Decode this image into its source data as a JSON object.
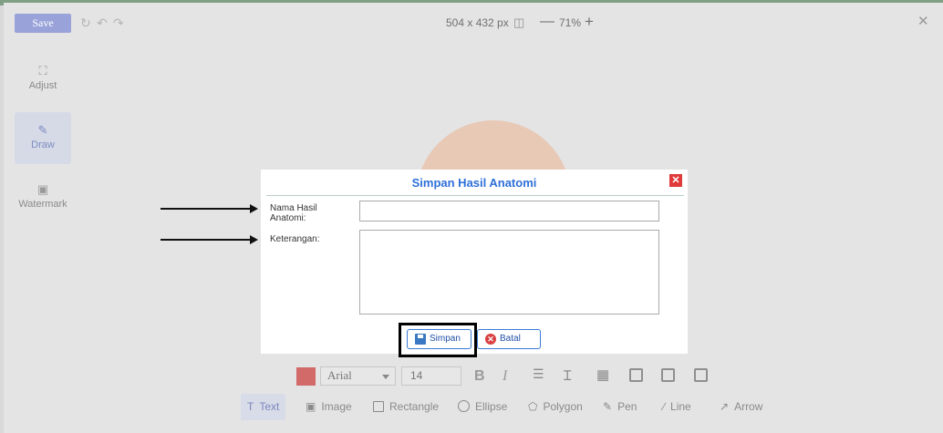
{
  "editor": {
    "save_label": "Save",
    "dimensions": "504 x 432 px",
    "zoom": "71%",
    "undo_icon": "rotate-icon",
    "sidebar": [
      {
        "label": "Adjust",
        "icon": "crop-icon"
      },
      {
        "label": "Draw",
        "icon": "pencil-square-icon"
      },
      {
        "label": "Watermark",
        "icon": "image-icon"
      }
    ],
    "text_toolbar": {
      "color": "#d26a6a",
      "font": "Arial",
      "font_size": "14",
      "bold": "B",
      "italic": "I"
    },
    "tools": [
      {
        "label": "Text",
        "icon": "text-cursor-icon"
      },
      {
        "label": "Image",
        "icon": "image-icon"
      },
      {
        "label": "Rectangle",
        "icon": "rectangle-icon"
      },
      {
        "label": "Ellipse",
        "icon": "ellipse-icon"
      },
      {
        "label": "Polygon",
        "icon": "polygon-icon"
      },
      {
        "label": "Pen",
        "icon": "pen-icon"
      },
      {
        "label": "Line",
        "icon": "line-icon"
      },
      {
        "label": "Arrow",
        "icon": "arrow-icon"
      }
    ]
  },
  "dialog": {
    "title": "Simpan Hasil Anatomi",
    "name_label": "Nama Hasil Anatomi:",
    "name_value": "",
    "desc_label": "Keterangan:",
    "desc_value": "",
    "save_button": "Simpan",
    "cancel_button": "Batal",
    "accent": "#2e6fd8",
    "close_color": "#e03a3a"
  }
}
